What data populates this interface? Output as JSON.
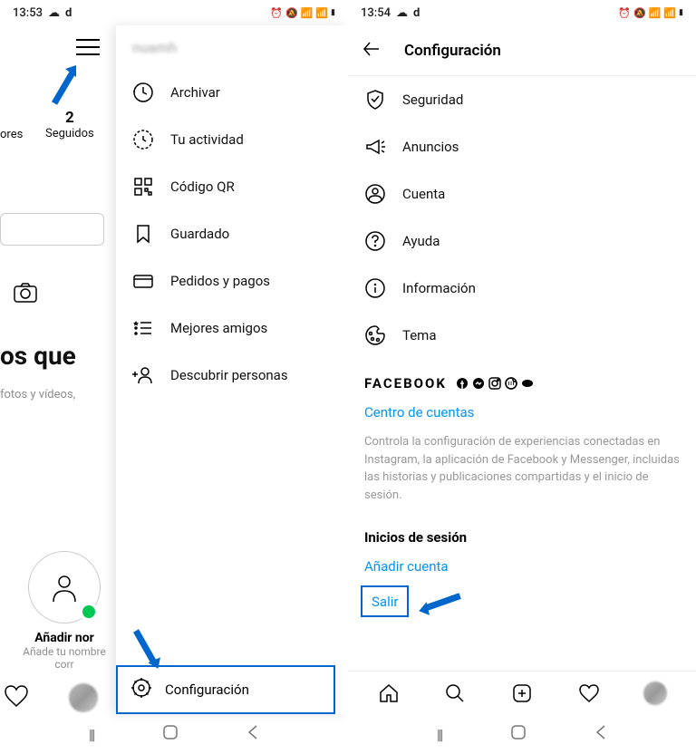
{
  "left": {
    "status_time": "13:53",
    "status_icons": "⏰ 🔕 📶 📶 🔋",
    "stat_value": "2",
    "stat_label": "Seguidos",
    "ores_fragment": "ores",
    "heading_fragment": "os que",
    "subtext": "fotos y vídeos,",
    "add_name": "Añadir nor",
    "add_sub": "Añade tu nombre corr",
    "menu": {
      "username": "nuamh",
      "items": [
        {
          "label": "Archivar"
        },
        {
          "label": "Tu actividad"
        },
        {
          "label": "Código QR"
        },
        {
          "label": "Guardado"
        },
        {
          "label": "Pedidos y pagos"
        },
        {
          "label": "Mejores amigos"
        },
        {
          "label": "Descubrir personas"
        }
      ],
      "settings": "Configuración"
    }
  },
  "right": {
    "status_time": "13:54",
    "title": "Configuración",
    "items": [
      {
        "label": "Seguridad"
      },
      {
        "label": "Anuncios"
      },
      {
        "label": "Cuenta"
      },
      {
        "label": "Ayuda"
      },
      {
        "label": "Información"
      },
      {
        "label": "Tema"
      }
    ],
    "facebook": "FACEBOOK",
    "accounts_center": "Centro de cuentas",
    "fb_desc": "Controla la configuración de experiencias conectadas en Instagram, la aplicación de Facebook y Messenger, incluidas las historias y publicaciones compartidas y el inicio de sesión.",
    "logins_title": "Inicios de sesión",
    "add_account": "Añadir cuenta",
    "logout": "Salir"
  }
}
